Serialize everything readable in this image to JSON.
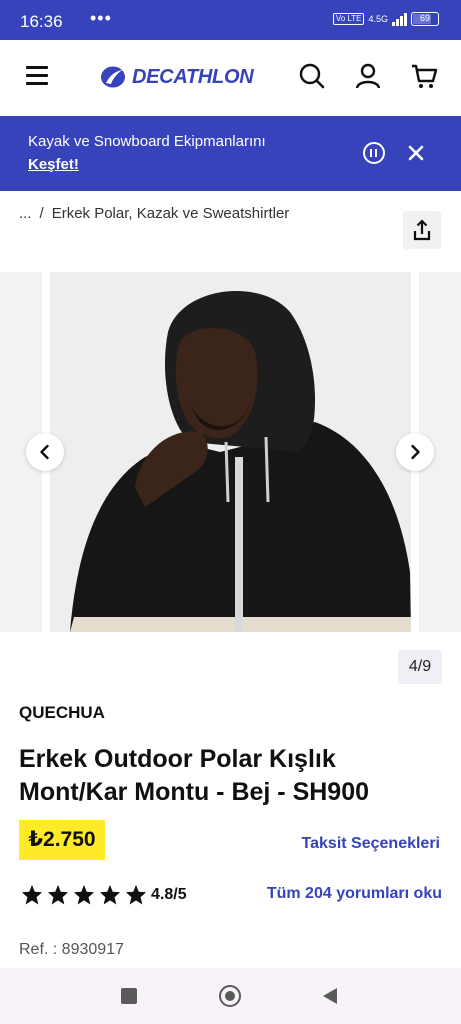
{
  "status_bar": {
    "time": "16:36",
    "dots": "•••",
    "volte": "Vo LTE",
    "network": "4.5G",
    "battery": "69"
  },
  "header": {
    "logo_text": "DECATHLON",
    "icons": [
      "menu-icon",
      "search-icon",
      "account-icon",
      "cart-icon"
    ]
  },
  "promo": {
    "text": "Kayak ve Snowboard Ekipmanlarını",
    "link": "Keşfet!"
  },
  "breadcrumb": {
    "ellipsis": "...",
    "separator": "/",
    "current": "Erkek Polar, Kazak ve Sweatshirtler"
  },
  "gallery": {
    "counter": "4/9",
    "image_alt": "Man wearing black fleece hooded jacket"
  },
  "product": {
    "brand": "QUECHUA",
    "title": "Erkek Outdoor Polar Kışlık Mont/Kar Montu - Bej - SH900",
    "price": "₺2.750",
    "installments_link": "Taksit Seçenekleri",
    "rating_value": "4.8/5",
    "stars": 4.8,
    "reviews_link": "Tüm 204 yorumları oku",
    "ref": "Ref. : 8930917"
  },
  "colors": {
    "brand_blue": "#3643ba",
    "price_yellow": "#ffea28"
  }
}
